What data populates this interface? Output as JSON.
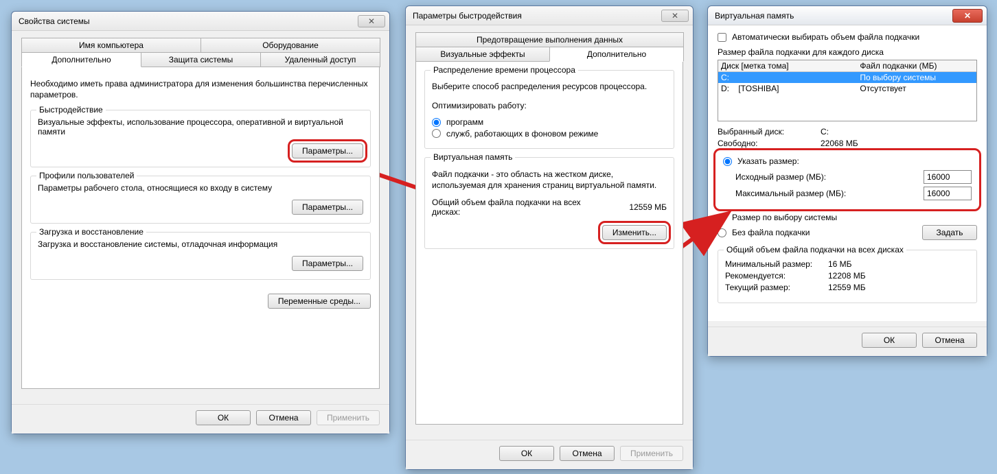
{
  "win1": {
    "title": "Свойства системы",
    "close": "✕",
    "tabs_row1": [
      "Имя компьютера",
      "Оборудование"
    ],
    "tabs_row2": [
      "Дополнительно",
      "Защита системы",
      "Удаленный доступ"
    ],
    "intro": "Необходимо иметь права администратора для изменения большинства перечисленных параметров.",
    "g1": {
      "title": "Быстродействие",
      "text": "Визуальные эффекты, использование процессора, оперативной и виртуальной памяти",
      "btn": "Параметры..."
    },
    "g2": {
      "title": "Профили пользователей",
      "text": "Параметры рабочего стола, относящиеся ко входу в систему",
      "btn": "Параметры..."
    },
    "g3": {
      "title": "Загрузка и восстановление",
      "text": "Загрузка и восстановление системы, отладочная информация",
      "btn": "Параметры..."
    },
    "env_btn": "Переменные среды...",
    "ok": "ОК",
    "cancel": "Отмена",
    "apply": "Применить"
  },
  "win2": {
    "title": "Параметры быстродействия",
    "close": "✕",
    "tab_top": "Предотвращение выполнения данных",
    "tabs_row2": [
      "Визуальные эффекты",
      "Дополнительно"
    ],
    "g1": {
      "title": "Распределение времени процессора",
      "text": "Выберите способ распределения ресурсов процессора.",
      "opt_label": "Оптимизировать работу:",
      "r1": "программ",
      "r2": "служб, работающих в фоновом режиме"
    },
    "g2": {
      "title": "Виртуальная память",
      "text1": "Файл подкачки - это область на жестком диске, используемая для хранения страниц виртуальной памяти.",
      "text2_lbl": "Общий объем файла подкачки на всех дисках:",
      "text2_val": "12559 МБ",
      "btn": "Изменить..."
    },
    "ok": "ОК",
    "cancel": "Отмена",
    "apply": "Применить"
  },
  "win3": {
    "title": "Виртуальная память",
    "close": "✕",
    "auto_cb": "Автоматически выбирать объем файла подкачки",
    "list_label": "Размер файла подкачки для каждого диска",
    "col1": "Диск [метка тома]",
    "col2": "Файл подкачки (МБ)",
    "rows": [
      {
        "d": "C:",
        "p": "По выбору системы",
        "sel": true
      },
      {
        "d": "D:    [TOSHIBA]",
        "p": "Отсутствует",
        "sel": false
      }
    ],
    "sel_drive_lbl": "Выбранный диск:",
    "sel_drive_val": "C:",
    "free_lbl": "Свободно:",
    "free_val": "22068 МБ",
    "r_custom": "Указать размер:",
    "init_lbl": "Исходный размер (МБ):",
    "init_val": "16000",
    "max_lbl": "Максимальный размер (МБ):",
    "max_val": "16000",
    "r_system": "Размер по выбору системы",
    "r_none": "Без файла подкачки",
    "set_btn": "Задать",
    "total_title": "Общий объем файла подкачки на всех дисках",
    "min_lbl": "Минимальный размер:",
    "min_val": "16 МБ",
    "rec_lbl": "Рекомендуется:",
    "rec_val": "12208 МБ",
    "cur_lbl": "Текущий размер:",
    "cur_val": "12559 МБ",
    "ok": "ОК",
    "cancel": "Отмена"
  }
}
